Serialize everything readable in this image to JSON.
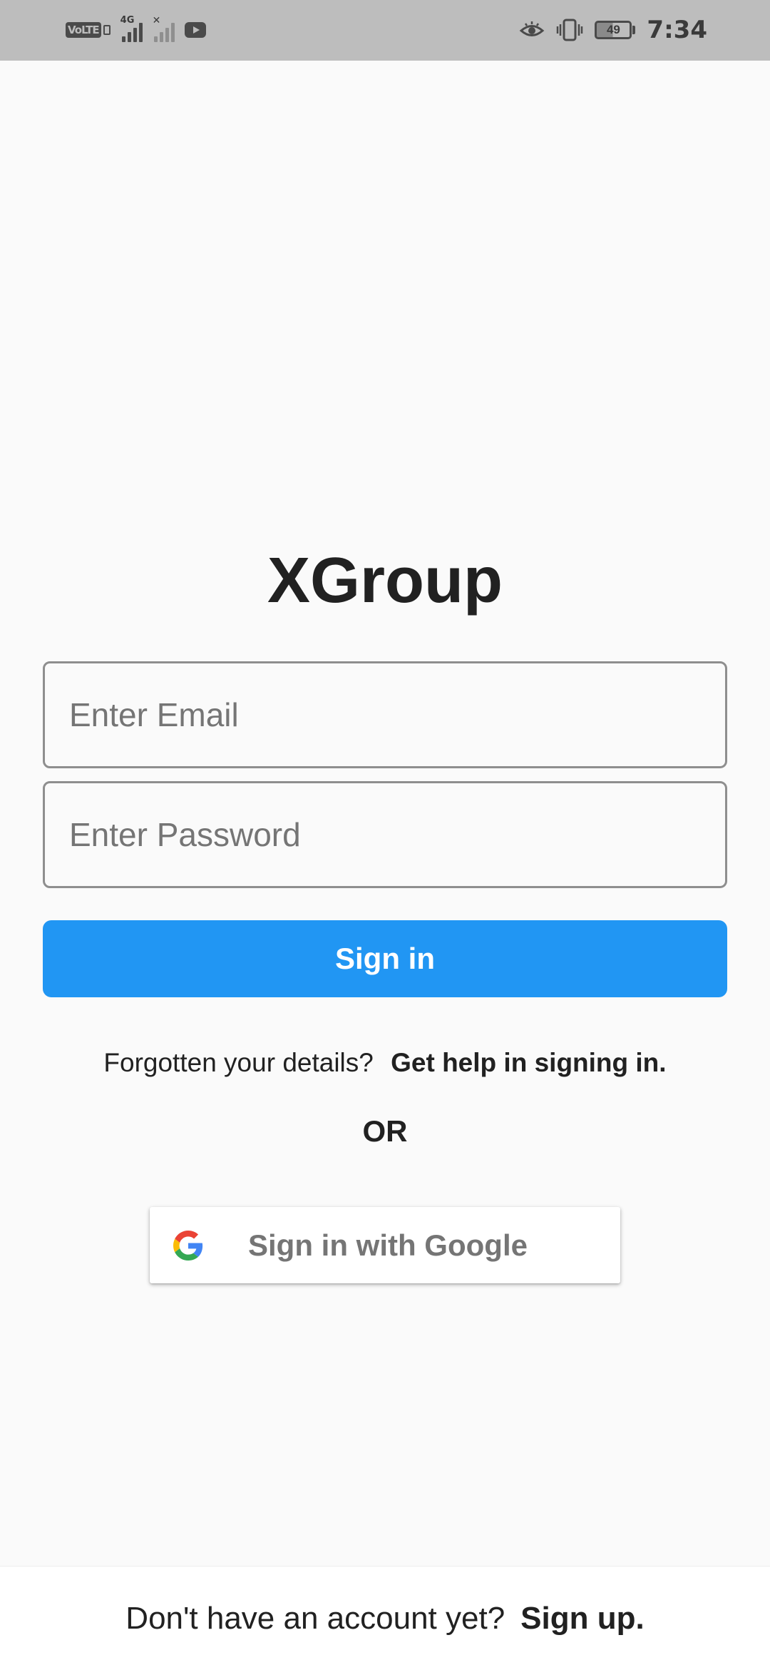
{
  "status_bar": {
    "network_badge": "VoLTE",
    "network_type": "4G",
    "battery_level": "49",
    "time": "7:34",
    "icons": [
      "volte-icon",
      "signal-4g-icon",
      "signal-no-sim-icon",
      "youtube-icon",
      "eye-comfort-icon",
      "vibrate-icon",
      "battery-icon"
    ]
  },
  "app": {
    "title": "XGroup"
  },
  "form": {
    "email_placeholder": "Enter Email",
    "email_value": "",
    "password_placeholder": "Enter Password",
    "password_value": "",
    "signin_label": "Sign in"
  },
  "help": {
    "prompt": "Forgotten your details?",
    "link": "Get help in signing in."
  },
  "divider": {
    "or_label": "OR"
  },
  "google": {
    "label": "Sign in with Google",
    "icon": "google-icon"
  },
  "footer": {
    "prompt": "Don't have an account yet?",
    "link": "Sign up."
  },
  "colors": {
    "primary": "#2196f3",
    "background": "#fafafa",
    "status_bar": "#bdbdbd",
    "text": "#212121"
  }
}
